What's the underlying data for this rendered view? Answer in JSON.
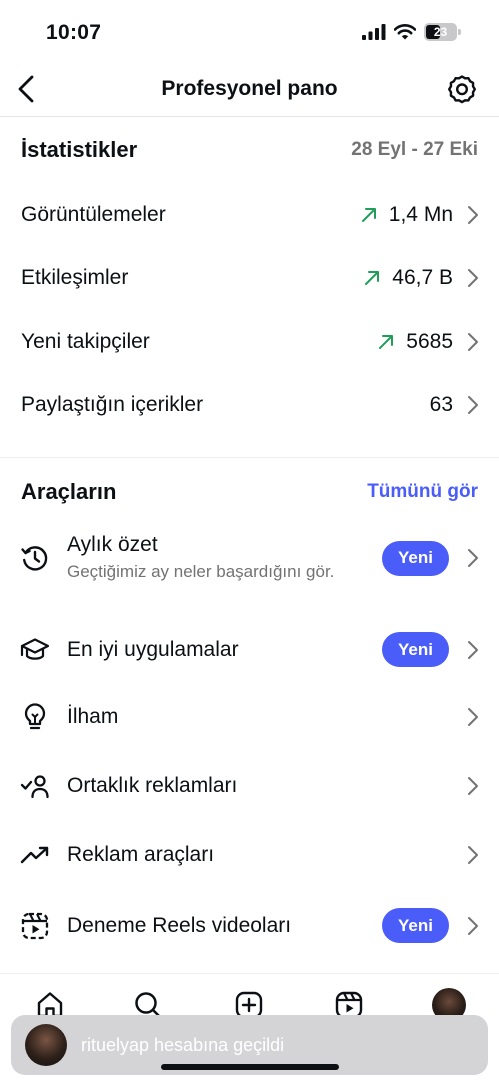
{
  "status_bar": {
    "time": "10:07",
    "battery": "23"
  },
  "nav": {
    "title": "Profesyonel pano",
    "back_icon": "chevron-left-icon",
    "settings_icon": "gear-icon"
  },
  "insights": {
    "title": "İstatistikler",
    "date_range": "28 Eyl - 27 Eki",
    "rows": [
      {
        "label": "Görüntülemeler",
        "value": "1,4 Mn",
        "trend": "up"
      },
      {
        "label": "Etkileşimler",
        "value": "46,7 B",
        "trend": "up"
      },
      {
        "label": "Yeni takipçiler",
        "value": "5685",
        "trend": "up"
      },
      {
        "label": "Paylaştığın içerikler",
        "value": "63",
        "trend": "none"
      }
    ]
  },
  "tools": {
    "title": "Araçların",
    "see_all": "Tümünü gör",
    "badge": "Yeni",
    "items": [
      {
        "label": "Aylık özet",
        "sub": "Geçtiğimiz ay neler başardığını gör.",
        "icon": "history-clock-icon",
        "badge": true
      },
      {
        "label": "En iyi uygulamalar",
        "icon": "graduation-cap-icon",
        "badge": true
      },
      {
        "label": "İlham",
        "icon": "lightbulb-icon",
        "badge": false
      },
      {
        "label": "Ortaklık reklamları",
        "icon": "partner-check-icon",
        "badge": false
      },
      {
        "label": "Reklam araçları",
        "icon": "trending-up-icon",
        "badge": false
      },
      {
        "label": "Deneme Reels videoları",
        "icon": "reels-icon",
        "badge": true
      }
    ]
  },
  "tabs": [
    "home-icon",
    "search-icon",
    "create-icon",
    "reels-icon",
    "profile-avatar"
  ],
  "toast": {
    "text": "rituelyap hesabına geçildi"
  },
  "colors": {
    "accent": "#4a5df9",
    "trend_up": "#1f9e5a",
    "muted": "#737373"
  }
}
